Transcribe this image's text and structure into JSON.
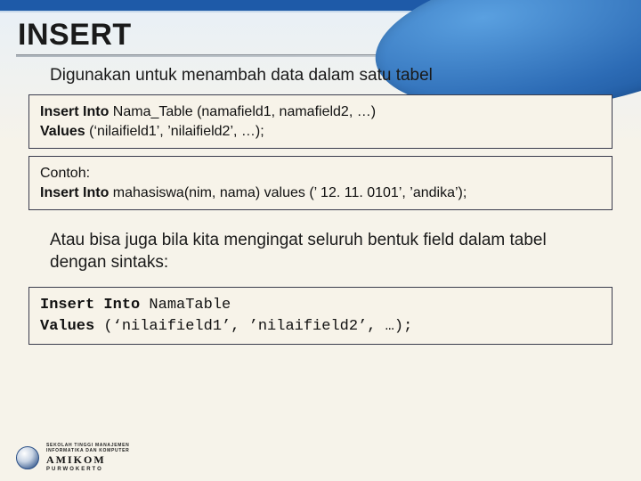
{
  "title": "INSERT",
  "lead": "Digunakan untuk menambah data dalam satu tabel",
  "box1": {
    "line1_bold": "Insert Into",
    "line1_rest": " Nama_Table (namafield1, namafield2, …)",
    "line2_bold": "Values",
    "line2_rest": " (‘nilaifield1’, ’nilaifield2’, …);"
  },
  "box2": {
    "line1": "Contoh:",
    "line2_bold": "Insert Into",
    "line2_rest": " mahasiswa(nim, nama) values (’ 12. 11. 0101’, ’andika’);"
  },
  "mid": "Atau bisa juga bila kita mengingat seluruh bentuk field dalam tabel dengan sintaks:",
  "box3": {
    "line1_bold": "Insert Into",
    "line1_rest": " NamaTable",
    "line2_bold": "Values",
    "line2_rest": " (‘nilaifield1’, ’nilaifield2’, …);"
  },
  "footer": {
    "line1": "SEKOLAH TINGGI MANAJEMEN",
    "line1b": "INFORMATIKA DAN KOMPUTER",
    "line2": "AMIKOM",
    "line3": "PURWOKERTO"
  }
}
